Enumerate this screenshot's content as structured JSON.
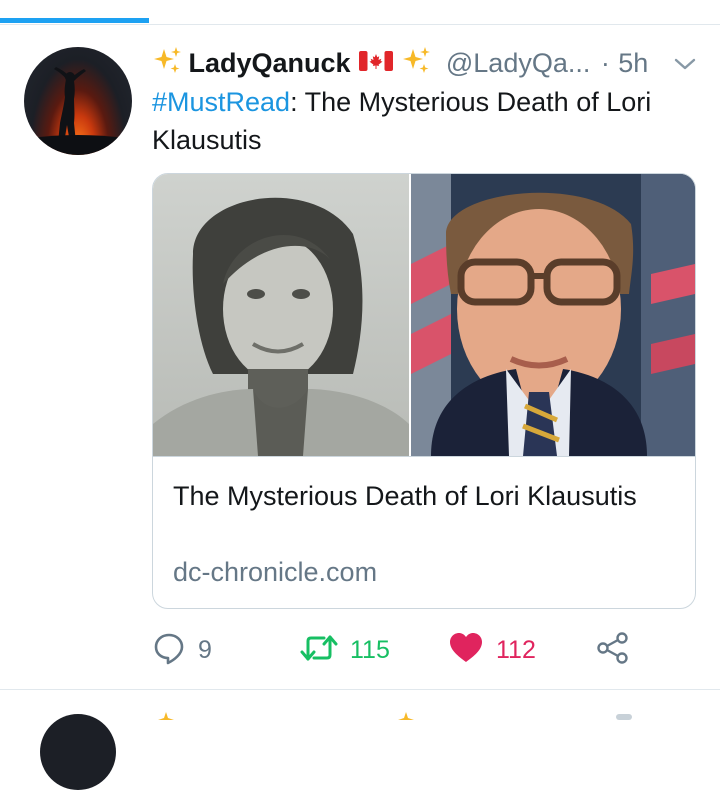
{
  "tweet": {
    "display_name": "LadyQanuck",
    "handle": "@LadyQa...",
    "time_sep": "·",
    "time": "5h",
    "hashtag": "#MustRead",
    "text_rest": ": The Mysterious Death of Lori Klausutis",
    "card": {
      "title": "The Mysterious Death of Lori Klausutis",
      "domain": "dc-chronicle.com"
    },
    "actions": {
      "replies": "9",
      "retweets": "115",
      "likes": "112"
    }
  },
  "colors": {
    "accent": "#1da1f2",
    "hashtag": "#1b95e0",
    "retweet": "#17bf63",
    "like": "#e0245e",
    "secondary_text": "#657786"
  },
  "icons": [
    "sparkles-icon",
    "canada-flag-icon",
    "chevron-down-icon",
    "reply-icon",
    "retweet-icon",
    "heart-icon",
    "share-icon"
  ]
}
